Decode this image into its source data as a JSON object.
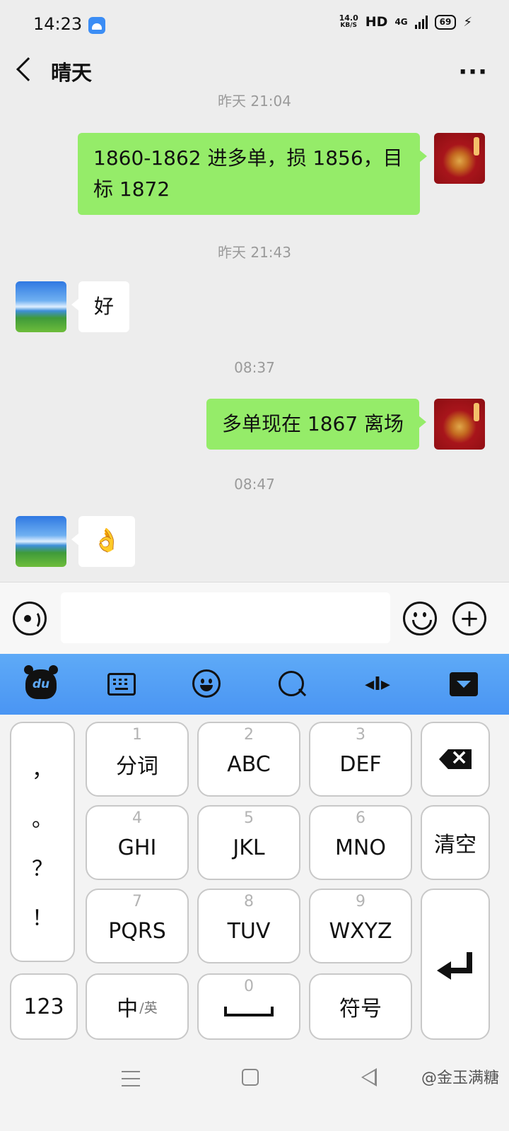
{
  "status_bar": {
    "time": "14:23",
    "speed_value": "14.0",
    "speed_unit": "KB/S",
    "hd": "HD",
    "network": "4G",
    "battery": "69"
  },
  "header": {
    "title": "晴天"
  },
  "chat": {
    "partial_timestamp": "昨天 21:04",
    "messages": [
      {
        "sender": "me",
        "text": "1860-1862 进多单，损 1856，目标 1872"
      },
      {
        "timestamp": "昨天 21:43"
      },
      {
        "sender": "other",
        "text": "好"
      },
      {
        "timestamp": "08:37"
      },
      {
        "sender": "me",
        "text": "多单现在 1867 离场"
      },
      {
        "timestamp": "08:47"
      },
      {
        "sender": "other",
        "text": "👌",
        "type": "emoji"
      }
    ]
  },
  "input_bar": {
    "value": "",
    "placeholder": ""
  },
  "keyboard": {
    "punctuation": [
      "，",
      "。",
      "？",
      "！"
    ],
    "keys": [
      {
        "num": "1",
        "label": "分词"
      },
      {
        "num": "2",
        "label": "ABC"
      },
      {
        "num": "3",
        "label": "DEF"
      },
      {
        "num": "4",
        "label": "GHI"
      },
      {
        "num": "5",
        "label": "JKL"
      },
      {
        "num": "6",
        "label": "MNO"
      },
      {
        "num": "7",
        "label": "PQRS"
      },
      {
        "num": "8",
        "label": "TUV"
      },
      {
        "num": "9",
        "label": "WXYZ"
      }
    ],
    "clear_label": "清空",
    "numeric_label": "123",
    "lang_main": "中",
    "lang_alt": "/英",
    "space_num": "0",
    "symbols_label": "符号"
  },
  "watermark": "@金玉满糖",
  "colors": {
    "my_bubble": "#95ec69",
    "toolbar": "#5ea9f6",
    "chat_bg": "#ededed"
  }
}
